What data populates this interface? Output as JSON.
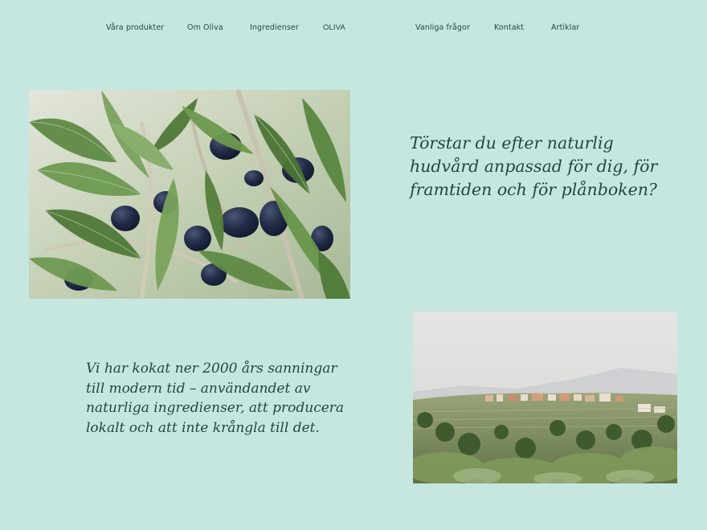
{
  "nav": {
    "left_items": [
      "Våra produkter",
      "Om Oliva",
      "Ingredienser"
    ],
    "logo": "OLIVA",
    "right_items": [
      "Vanliga frågor",
      "Kontakt",
      "Artiklar"
    ]
  },
  "hero": {
    "image_subject": "olive branch with dark olives",
    "headline": "Törstar du efter naturlig hudvård anpassad för dig, för framtiden och för plånboken?"
  },
  "about": {
    "image_subject": "landscape with olive groves and a hillside village",
    "text": "Vi har kokat ner 2000 års sanningar till modern tid – användandet av naturliga ingredienser, att producera lokalt och att inte krångla till det."
  },
  "colors": {
    "background": "#c6e7e0",
    "text": "#1f4a3b"
  }
}
